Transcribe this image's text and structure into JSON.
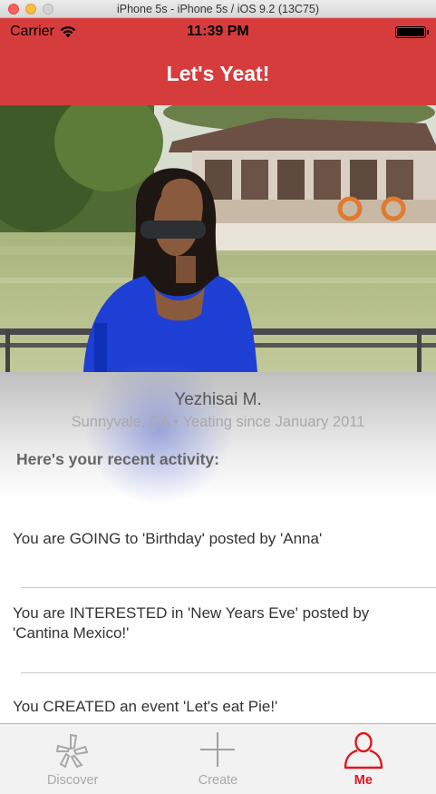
{
  "window": {
    "title": "iPhone 5s - iPhone 5s / iOS 9.2 (13C75)"
  },
  "status_bar": {
    "carrier": "Carrier",
    "time": "11:39 PM",
    "battery_level": 1.0
  },
  "nav": {
    "title": "Let's Yeat!"
  },
  "profile": {
    "name": "Yezhisai M.",
    "location": "Sunnyvale, CA",
    "separator": "•",
    "since": "Yeating since January 2011"
  },
  "activity": {
    "heading": "Here's your recent activity:",
    "items": [
      "You are GOING to 'Birthday' posted by 'Anna'",
      "You are INTERESTED in 'New Years Eve' posted by 'Cantina Mexico!'",
      "You CREATED an event 'Let's eat Pie!'"
    ]
  },
  "tabs": [
    {
      "label": "Discover",
      "icon": "yelp-burst-icon",
      "active": false
    },
    {
      "label": "Create",
      "icon": "plus-icon",
      "active": false
    },
    {
      "label": "Me",
      "icon": "person-icon",
      "active": true
    }
  ],
  "colors": {
    "brand_red": "#d73c3d",
    "active_tab": "#e0161f",
    "inactive_tab": "#a8a8a8"
  }
}
